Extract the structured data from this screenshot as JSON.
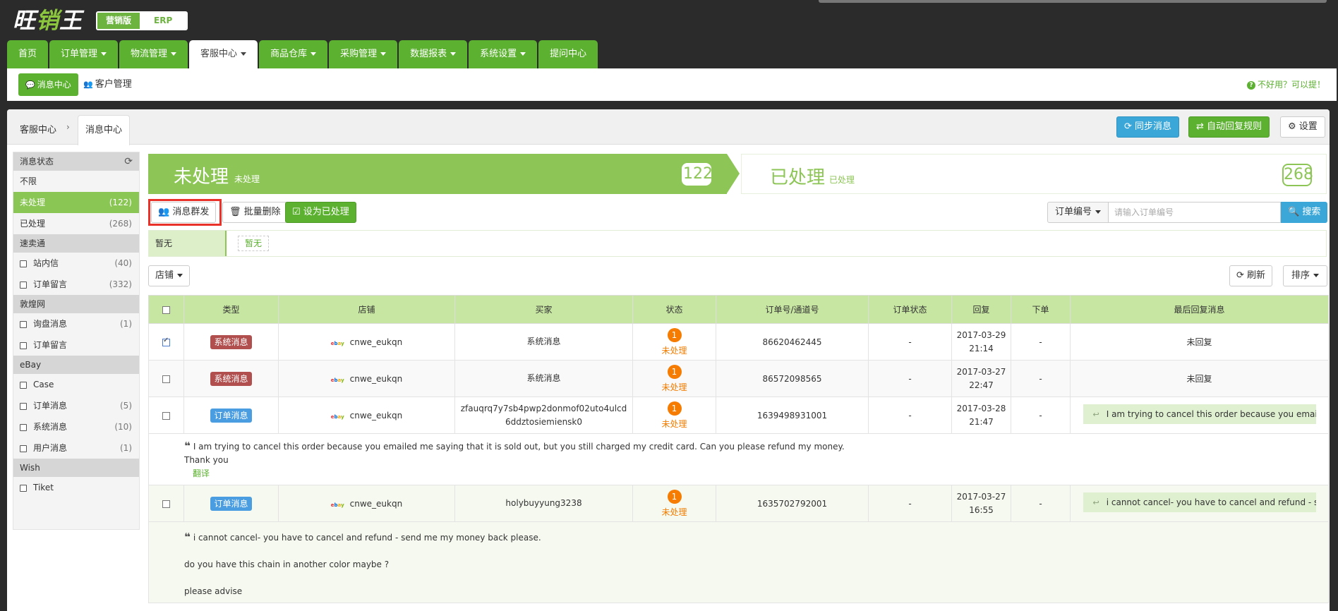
{
  "app": {
    "logo_a": "旺",
    "logo_b": "销",
    "logo_c": "王",
    "edition_marketing": "营销版",
    "edition_erp": "ERP"
  },
  "nav": {
    "tabs": [
      {
        "label": "首页",
        "dropdown": false
      },
      {
        "label": "订单管理",
        "dropdown": true
      },
      {
        "label": "物流管理",
        "dropdown": true
      },
      {
        "label": "客服中心",
        "dropdown": true,
        "active": true
      },
      {
        "label": "商品仓库",
        "dropdown": true
      },
      {
        "label": "采购管理",
        "dropdown": true
      },
      {
        "label": "数据报表",
        "dropdown": true
      },
      {
        "label": "系统设置",
        "dropdown": true
      },
      {
        "label": "提问中心",
        "dropdown": false
      }
    ]
  },
  "subnav": {
    "message_center": "消息中心",
    "customer_manage": "客户管理",
    "help": "不好用？可以提！"
  },
  "breadcrumb": {
    "root": "客服中心",
    "sep": "›",
    "current": "消息中心"
  },
  "toolbar": {
    "sync": "同步消息",
    "auto_reply": "自动回复规则",
    "settings": "设置"
  },
  "sidebar": {
    "groups": [
      {
        "title": "消息状态",
        "refresh": true,
        "items": [
          {
            "label": "不限",
            "count": "",
            "checkbox": false
          },
          {
            "label": "未处理",
            "count": "(122)",
            "checkbox": false,
            "active": true
          },
          {
            "label": "已处理",
            "count": "(268)",
            "checkbox": false
          }
        ]
      },
      {
        "title": "速卖通",
        "items": [
          {
            "label": "站内信",
            "count": "(40)",
            "checkbox": true
          },
          {
            "label": "订单留言",
            "count": "(332)",
            "checkbox": true
          }
        ]
      },
      {
        "title": "敦煌网",
        "items": [
          {
            "label": "询盘消息",
            "count": "(1)",
            "checkbox": true
          },
          {
            "label": "订单留言",
            "count": "",
            "checkbox": true
          }
        ]
      },
      {
        "title": "eBay",
        "items": [
          {
            "label": "Case",
            "count": "",
            "checkbox": true
          },
          {
            "label": "订单消息",
            "count": "(5)",
            "checkbox": true
          },
          {
            "label": "系统消息",
            "count": "(10)",
            "checkbox": true
          },
          {
            "label": "用户消息",
            "count": "(1)",
            "checkbox": true
          }
        ]
      },
      {
        "title": "Wish",
        "items": [
          {
            "label": "Tiket",
            "count": "",
            "checkbox": true
          }
        ]
      }
    ]
  },
  "banner": {
    "pending_title": "未处理",
    "pending_sub": "未处理",
    "pending_count": "122",
    "done_title": "已处理",
    "done_sub": "已处理",
    "done_count": "268"
  },
  "actions": {
    "broadcast": "消息群发",
    "batch_delete": "批量删除",
    "mark_done": "设为已处理",
    "search_field": "订单编号",
    "search_placeholder": "请输入订单编号",
    "search_btn": "搜索"
  },
  "tags": {
    "label": "暂无",
    "tag": "暂无"
  },
  "filters": {
    "shop": "店铺",
    "refresh": "刷新",
    "sort": "排序"
  },
  "table": {
    "headers": [
      "类型",
      "店铺",
      "买家",
      "状态",
      "订单号/通道号",
      "订单状态",
      "回复",
      "下单",
      "最后回复消息"
    ],
    "rows": [
      {
        "checked": true,
        "type": "系统消息",
        "type_kind": "sys",
        "shop": "cnwe_eukqn",
        "buyer": "系统消息",
        "status_num": "1",
        "status": "未处理",
        "order_no": "86620462445",
        "order_status": "-",
        "reply_date": "2017-03-29",
        "reply_time": "21:14",
        "placed": "-",
        "last_reply": "未回复",
        "pill": false
      },
      {
        "checked": false,
        "type": "系统消息",
        "type_kind": "sys",
        "shop": "cnwe_eukqn",
        "buyer": "系统消息",
        "status_num": "1",
        "status": "未处理",
        "order_no": "86572098565",
        "order_status": "-",
        "reply_date": "2017-03-27",
        "reply_time": "22:47",
        "placed": "-",
        "last_reply": "未回复",
        "pill": false
      },
      {
        "checked": false,
        "type": "订单消息",
        "type_kind": "ord",
        "shop": "cnwe_eukqn",
        "buyer": "zfauqrq7y7sb4pwp2donmof02uto4ulcd6ddztosiemiensk0",
        "status_num": "1",
        "status": "未处理",
        "order_no": "1639498931001",
        "order_status": "-",
        "reply_date": "2017-03-28",
        "reply_time": "21:47",
        "placed": "-",
        "last_reply": "I am trying to cancel this order because you emaile",
        "pill": true
      },
      {
        "checked": false,
        "type": "订单消息",
        "type_kind": "ord",
        "shop": "cnwe_eukqn",
        "buyer": "holybuyyung3238",
        "status_num": "1",
        "status": "未处理",
        "order_no": "1635702792001",
        "order_status": "-",
        "reply_date": "2017-03-27",
        "reply_time": "16:55",
        "placed": "-",
        "last_reply": "i cannot cancel- you have to cancel and refund - se",
        "pill": true
      }
    ],
    "message1": {
      "line1": "I am trying to cancel this order because you emailed me saying that it is sold out, but you still charged my credit card. Can you please refund my money.",
      "line2": "Thank you",
      "translate": "翻译"
    },
    "message2": {
      "line1": "i cannot cancel- you have to cancel and refund - send me my money back please.",
      "line2": "do you have this chain in another color maybe ?",
      "line3": "please advise"
    }
  },
  "colors": {
    "brand_green": "#5cb130",
    "light_green": "#8dc657",
    "header_green": "#c7e6a2",
    "accent_blue": "#3ba7d8",
    "highlight_red": "#e8322a",
    "status_orange": "#f57c00"
  }
}
